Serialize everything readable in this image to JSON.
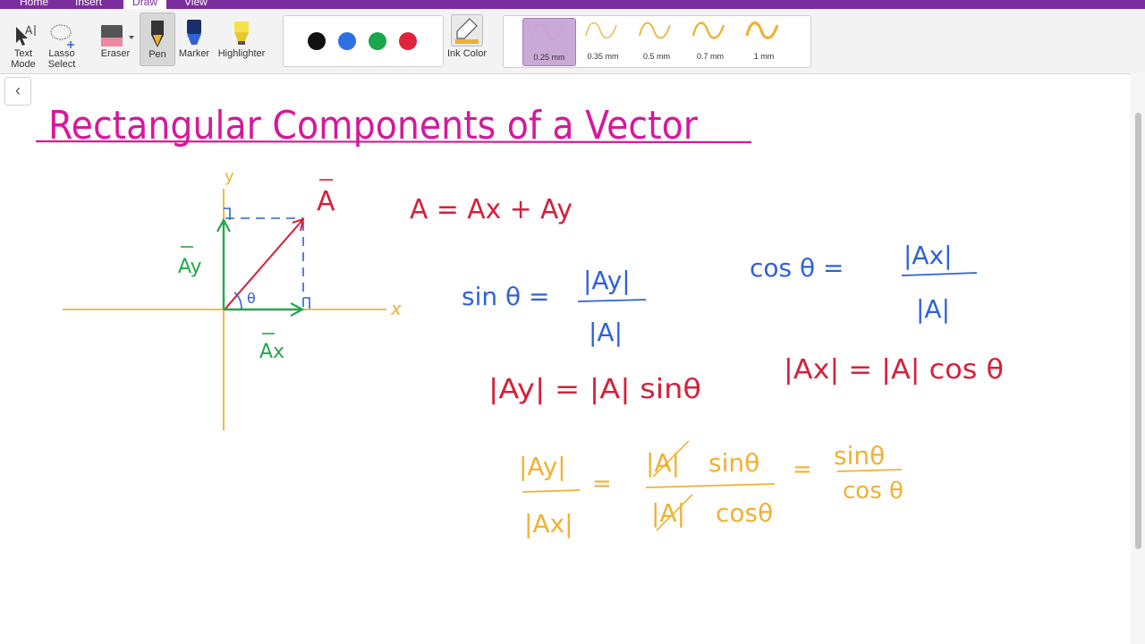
{
  "menu": {
    "tabs": [
      "Home",
      "Insert",
      "Draw",
      "View"
    ],
    "active": "Draw"
  },
  "ribbon": {
    "text_mode": [
      "Text",
      "Mode"
    ],
    "lasso_select": [
      "Lasso",
      "Select"
    ],
    "eraser": "Eraser",
    "pen": "Pen",
    "marker": "Marker",
    "highlighter": "Highlighter",
    "ink_color": "Ink Color",
    "pen_colors": [
      "#111111",
      "#2f6fe4",
      "#1aa64b",
      "#e0233a"
    ],
    "thickness": [
      "0.25 mm",
      "0.35 mm",
      "0.5 mm",
      "0.7 mm",
      "1 mm"
    ],
    "thickness_selected": "0.25 mm"
  },
  "note": {
    "title": "Rectangular Components of a Vector",
    "axis_y": "y",
    "axis_x": "x",
    "vec_A": "A",
    "vec_Ay": "Ay",
    "vec_Ax": "Ax",
    "angle": "θ",
    "eq_sum": "A = Ax + Ay",
    "sin_lhs": "sin θ =",
    "sin_num": "|Ay|",
    "sin_den": "|A|",
    "cos_lhs": "cos θ =",
    "cos_num": "|Ax|",
    "cos_den": "|A|",
    "ay_eq": "|Ay| = |A| sinθ",
    "ax_eq": "|Ax| = |A| cos θ",
    "ratio_lhs_num": "|Ay|",
    "ratio_lhs_den": "|Ax|",
    "ratio_mid_num_a": "|A|",
    "ratio_mid_num_b": "sinθ",
    "ratio_mid_den_a": "|A|",
    "ratio_mid_den_b": "cosθ",
    "eq": "=",
    "ratio_rhs_num": "sinθ",
    "ratio_rhs_den": "cos θ"
  },
  "colors": {
    "magenta": "#d6189c",
    "red": "#d4213a",
    "green": "#24a84a",
    "blue": "#2e62d6",
    "orange": "#f0b132",
    "purple": "#7b2c9e"
  }
}
